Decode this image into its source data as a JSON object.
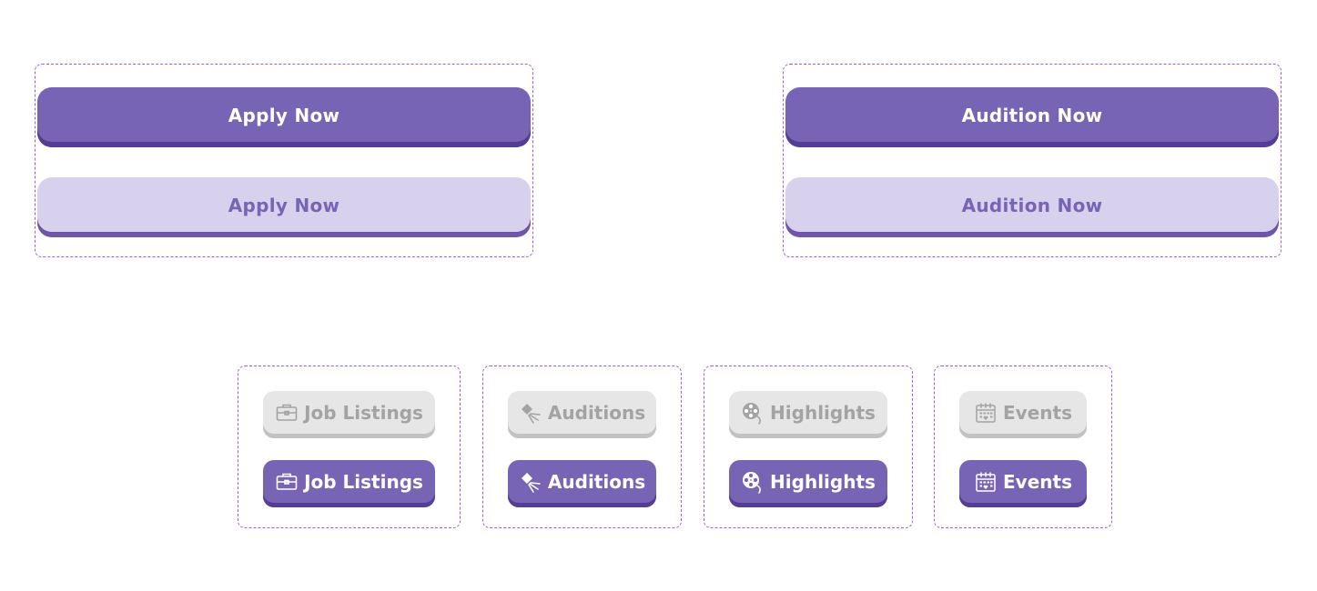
{
  "cta_groups": [
    {
      "primary_label": "Apply Now",
      "secondary_label": "Apply Now"
    },
    {
      "primary_label": "Audition Now",
      "secondary_label": "Audition Now"
    }
  ],
  "nav_pills": [
    {
      "label": "Job Listings",
      "icon": "briefcase-icon"
    },
    {
      "label": "Auditions",
      "icon": "spotlight-icon"
    },
    {
      "label": "Highlights",
      "icon": "film-reel-icon"
    },
    {
      "label": "Events",
      "icon": "calendar-icon"
    }
  ],
  "colors": {
    "accent": "#7764b4",
    "accent_shadow": "#553c95",
    "accent_soft": "#d8d1ee",
    "inactive_bg": "#e6e6e6",
    "inactive_text": "#a3a3a3",
    "frame_border": "#9b5cf0"
  }
}
